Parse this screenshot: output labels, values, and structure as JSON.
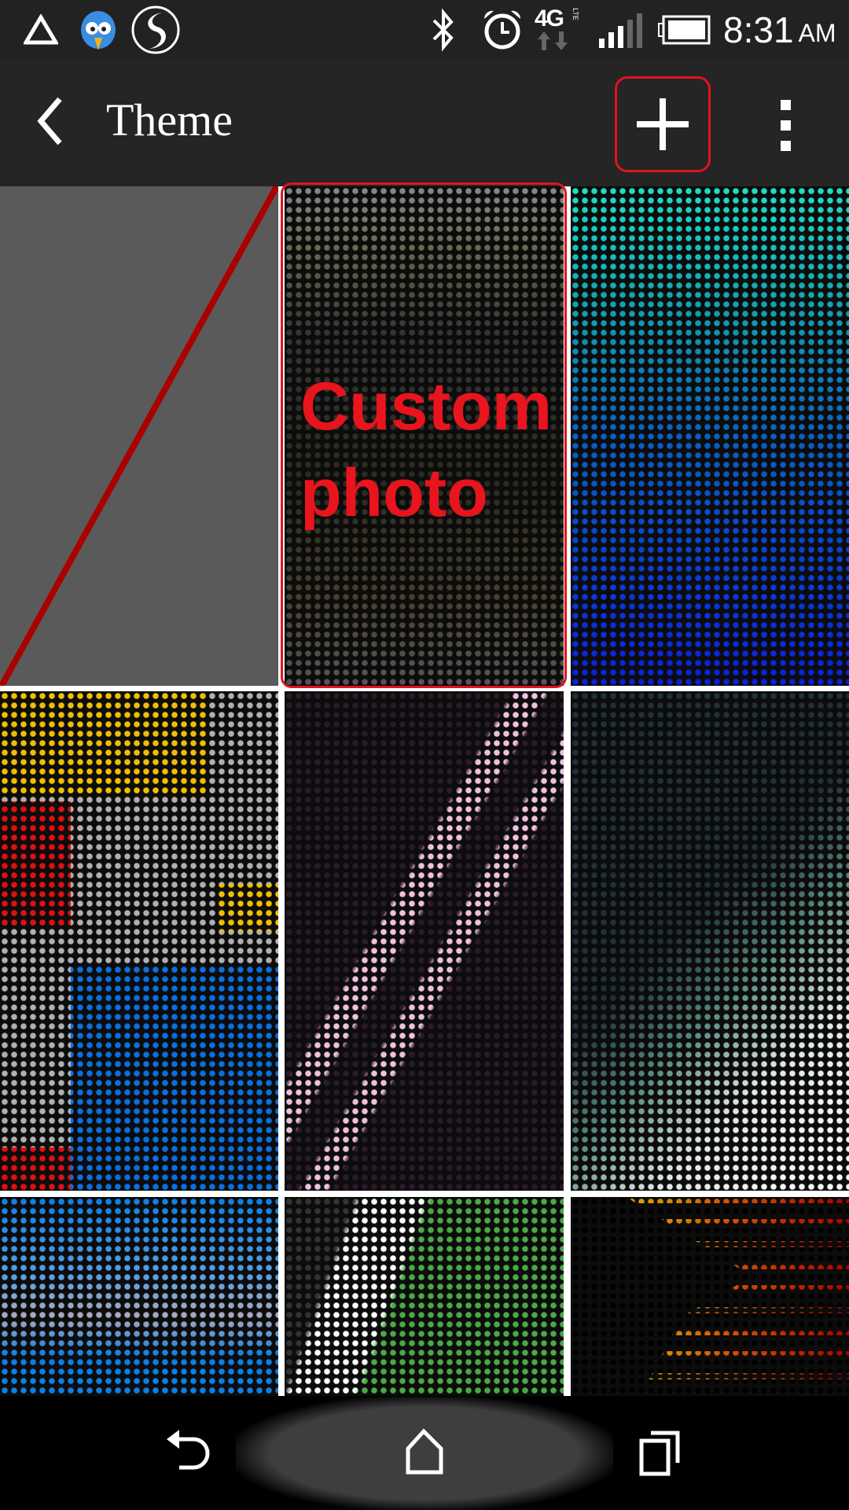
{
  "status_bar": {
    "time": "8:31",
    "ampm": "AM",
    "network": "4G",
    "network_sub": "LTE",
    "icons": [
      "warning-triangle-icon",
      "bird-app-icon",
      "swype-icon",
      "bluetooth-icon",
      "alarm-icon",
      "data-arrows-icon",
      "signal-icon",
      "battery-icon"
    ]
  },
  "action_bar": {
    "title": "Theme",
    "back_icon": "chevron-left-icon",
    "add_icon": "plus-icon",
    "more_icon": "more-vertical-icon"
  },
  "annotation": {
    "color": "#e0141e",
    "custom_label_line1": "Custom",
    "custom_label_line2": "photo"
  },
  "themes": [
    {
      "name": "gray-red-line"
    },
    {
      "name": "custom-photo"
    },
    {
      "name": "cyan-blue"
    },
    {
      "name": "mondrian"
    },
    {
      "name": "pink-stripes"
    },
    {
      "name": "teal-mountain"
    },
    {
      "name": "blue-gray"
    },
    {
      "name": "green-white"
    },
    {
      "name": "orange-red-bars"
    }
  ],
  "nav_bar": {
    "icons": [
      "back-icon",
      "home-icon",
      "recent-apps-icon"
    ]
  }
}
